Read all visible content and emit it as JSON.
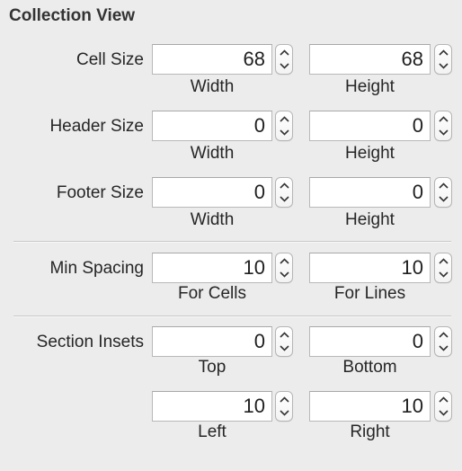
{
  "panel": {
    "title": "Collection View"
  },
  "rows": {
    "cell_size": {
      "label": "Cell Size",
      "first_value": "68",
      "second_value": "68",
      "first_caption": "Width",
      "second_caption": "Height"
    },
    "header_size": {
      "label": "Header Size",
      "first_value": "0",
      "second_value": "0",
      "first_caption": "Width",
      "second_caption": "Height"
    },
    "footer_size": {
      "label": "Footer Size",
      "first_value": "0",
      "second_value": "0",
      "first_caption": "Width",
      "second_caption": "Height"
    },
    "min_spacing": {
      "label": "Min Spacing",
      "first_value": "10",
      "second_value": "10",
      "first_caption": "For Cells",
      "second_caption": "For Lines"
    },
    "section_insets": {
      "label": "Section Insets",
      "top_value": "0",
      "bottom_value": "0",
      "top_caption": "Top",
      "bottom_caption": "Bottom",
      "left_value": "10",
      "right_value": "10",
      "left_caption": "Left",
      "right_caption": "Right"
    }
  },
  "icons": {
    "stepper_up": "chevron-up-icon",
    "stepper_down": "chevron-down-icon"
  }
}
